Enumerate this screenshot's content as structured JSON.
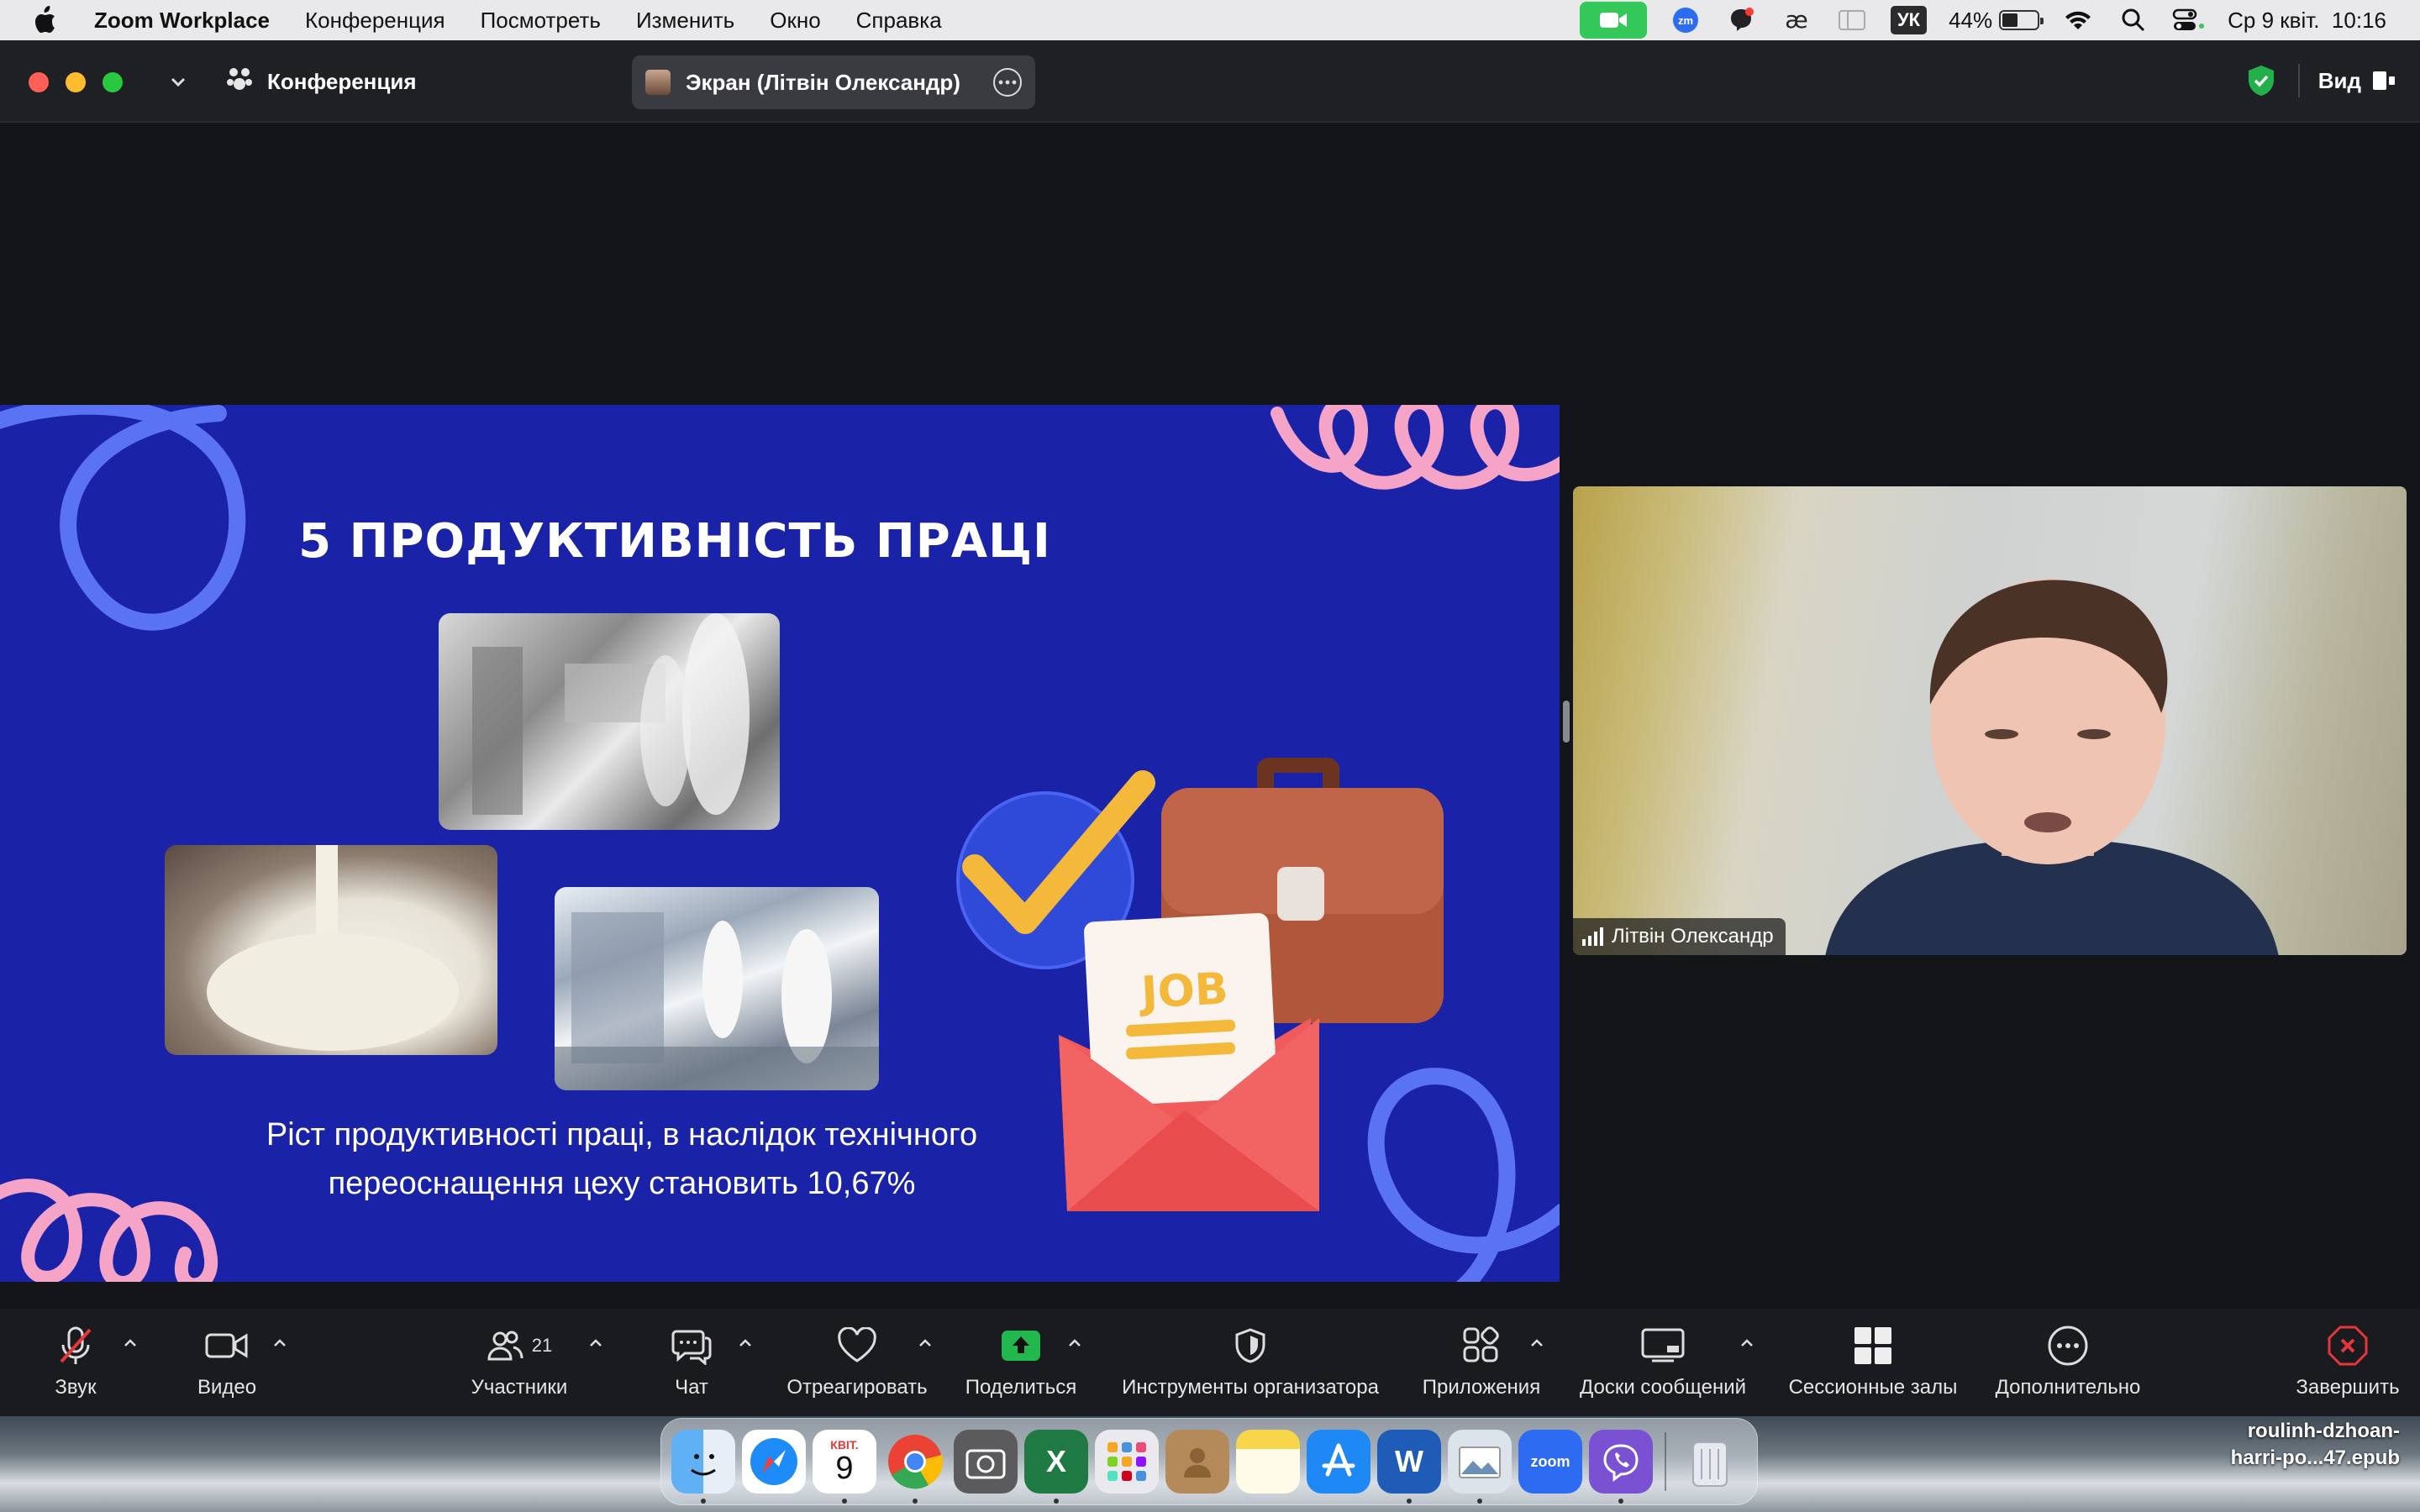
{
  "menubar": {
    "app_name": "Zoom Workplace",
    "items": [
      "Конференция",
      "Посмотреть",
      "Изменить",
      "Окно",
      "Справка"
    ],
    "keyboard_layout": "УК",
    "battery_percent": "44%",
    "battery_level": 0.44,
    "datetime": "Ср 9 квіт.  10:16"
  },
  "titlebar": {
    "meeting_label": "Конференция",
    "share_label": "Экран (Літвін Олександр)",
    "view_label": "Вид"
  },
  "slide": {
    "title": "5 ПРОДУКТИВНІСТЬ ПРАЦІ",
    "job_label": "JOB",
    "caption_line1": "Ріст продуктивності праці, в наслідок технічного",
    "caption_line2": "переоснащення цеху становить 10,67%"
  },
  "video": {
    "participant_name": "Літвін Олександр"
  },
  "toolbar": {
    "audio": "Звук",
    "video": "Видео",
    "participants": "Участники",
    "participants_count": "21",
    "chat": "Чат",
    "react": "Отреагировать",
    "share": "Поделиться",
    "host_tools": "Инструменты организатора",
    "apps": "Приложения",
    "whiteboards": "Доски сообщений",
    "breakout": "Сессионные залы",
    "more": "Дополнительно",
    "end": "Завершить"
  },
  "dock": {
    "calendar_month": "КВІТ.",
    "calendar_day": "9",
    "zoom_label": "zoom"
  },
  "desktop": {
    "file_line1": "roulinh-dzhoan-",
    "file_line2": "harri-po...47.epub"
  },
  "colors": {
    "slide_bg": "#1a22a8",
    "toolbar_bg": "#1a1b1f",
    "share_green": "#22b84e",
    "end_red": "#e5363a",
    "mute_red": "#e5363a"
  }
}
